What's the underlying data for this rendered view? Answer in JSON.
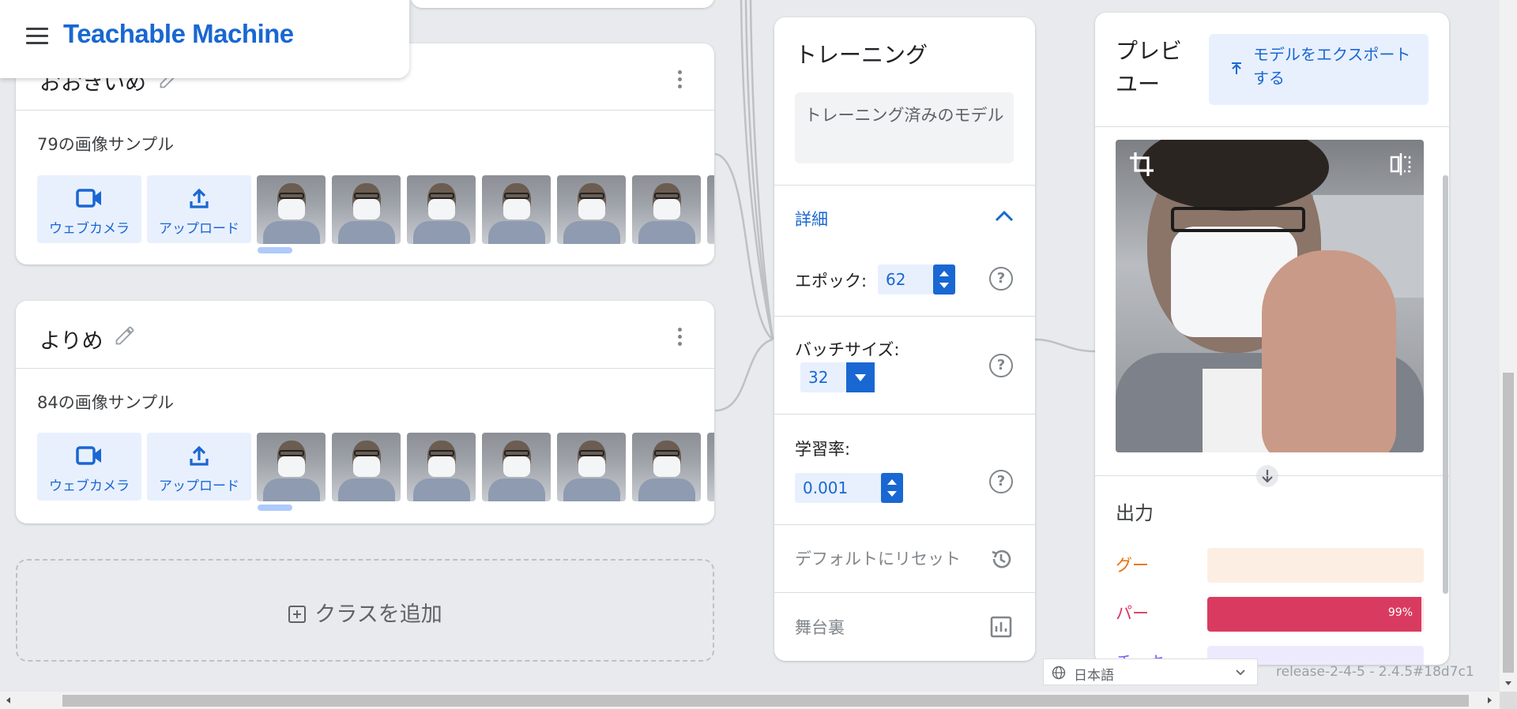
{
  "header": {
    "app_title": "Teachable Machine",
    "menu_icon": "menu-icon"
  },
  "classes": [
    {
      "name": "おおきいめ",
      "sample_count": "79の画像サンプル",
      "webcam_label": "ウェブカメラ",
      "upload_label": "アップロード"
    },
    {
      "name": "よりめ",
      "sample_count": "84の画像サンプル",
      "webcam_label": "ウェブカメラ",
      "upload_label": "アップロード"
    }
  ],
  "add_class": {
    "label": "クラスを追加"
  },
  "training": {
    "title": "トレーニング",
    "train_button": "トレーニング済みのモデル",
    "advanced_label": "詳細",
    "epochs_label": "エポック:",
    "epochs_value": "62",
    "batch_label": "バッチサイズ:",
    "batch_value": "32",
    "lr_label": "学習率:",
    "lr_value": "0.001",
    "reset_label": "デフォルトにリセット",
    "under_hood_label": "舞台裏"
  },
  "preview": {
    "title_line1": "プレビ",
    "title_line2": "ユー",
    "export_label": "モデルをエクスポートする",
    "output_title": "出力",
    "outputs": [
      {
        "label": "グー",
        "color": "#e8710a",
        "track": "#fdeee3",
        "value": 0
      },
      {
        "label": "パー",
        "color": "#d93b60",
        "track": "#fde4ea",
        "value": 0.99,
        "pct": "99%"
      },
      {
        "label": "チョキ",
        "color": "#7b5cf5",
        "track": "#eeeafe",
        "value": 0
      }
    ]
  },
  "footer": {
    "language": "日本語",
    "version": "release-2-4-5 - 2.4.5#18d7c1"
  },
  "colors": {
    "accent": "#1967d2",
    "accent_light": "#e8f0fe",
    "background": "#e8eaed"
  }
}
